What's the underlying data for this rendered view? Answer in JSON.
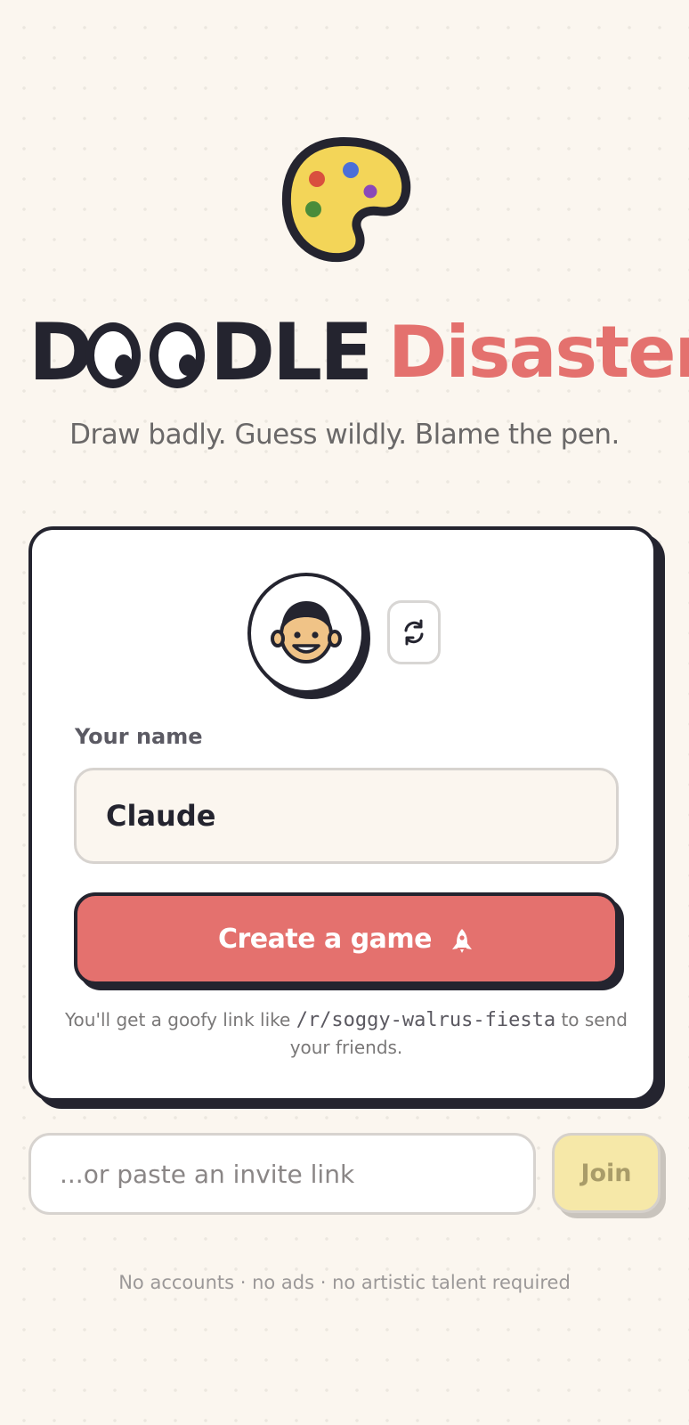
{
  "logo": {
    "icon": "palette-icon"
  },
  "title": {
    "word1_start": "D",
    "word1_end": "DLE",
    "word2": "Disaster"
  },
  "tagline": "Draw badly. Guess wildly. Blame the pen.",
  "card": {
    "avatar_icon": "face-avatar-icon",
    "refresh_icon": "refresh-icon",
    "name_label": "Your name",
    "name_value": "Claude",
    "create_button_label": "Create a game",
    "create_button_icon": "rocket-icon",
    "hint_before": "You'll get a goofy link like ",
    "hint_link": "/r/soggy-walrus-fiesta",
    "hint_after": " to send your friends."
  },
  "join": {
    "placeholder": "...or paste an invite link",
    "button_label": "Join"
  },
  "footer": "No accounts · no ads · no artistic talent required",
  "colors": {
    "background": "#fbf6ef",
    "ink": "#24242f",
    "accent_coral": "#e4716e",
    "join_yellow": "#f6e8a8"
  }
}
